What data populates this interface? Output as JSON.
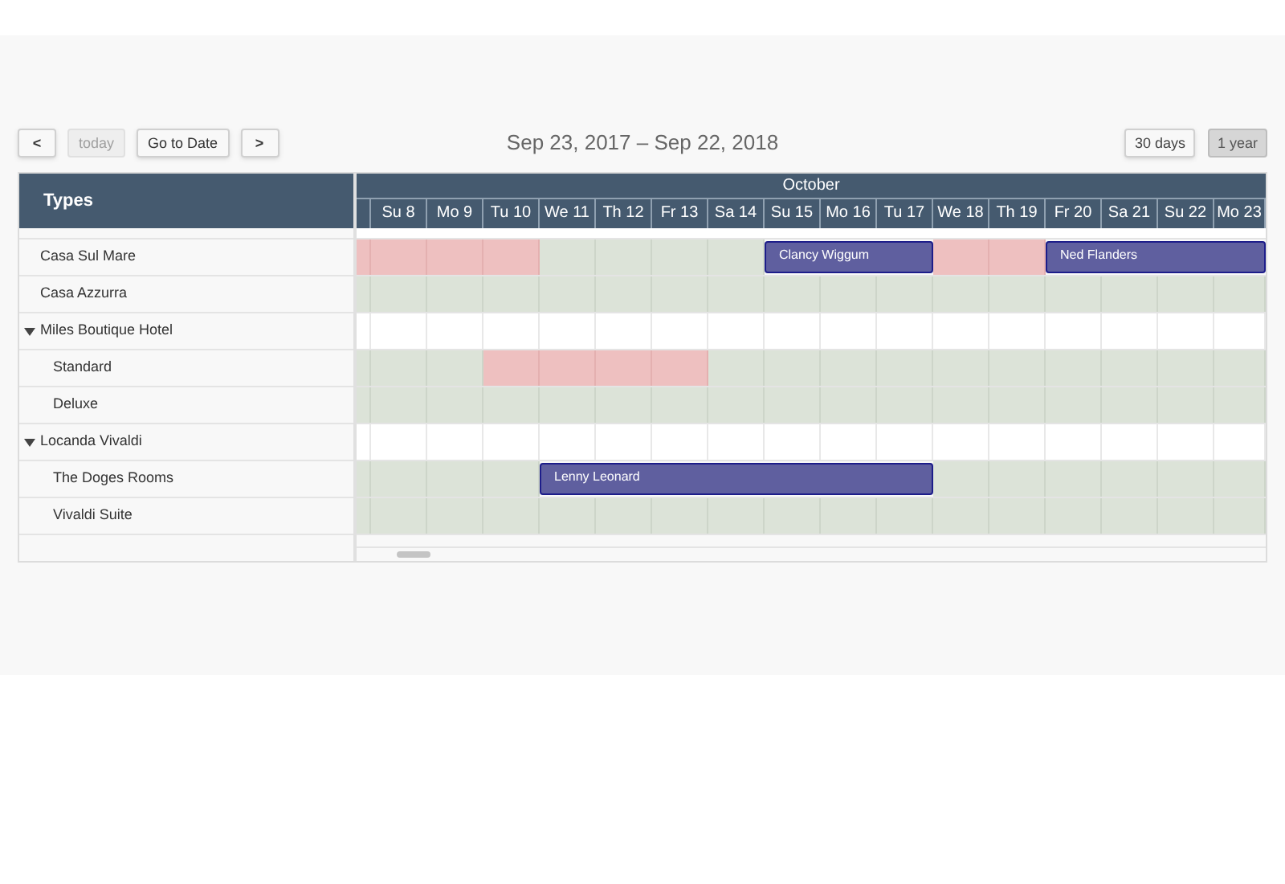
{
  "toolbar": {
    "nav_buttons": [
      {
        "label": "<",
        "kind": "prev",
        "disabled": false
      },
      {
        "label": "today",
        "kind": "today",
        "disabled": true
      },
      {
        "label": "Go to Date",
        "kind": "goto",
        "disabled": false
      },
      {
        "label": ">",
        "kind": "next",
        "disabled": false
      }
    ],
    "title": "Sep 23, 2017 – Sep 22, 2018",
    "view_buttons": [
      {
        "label": "30 days",
        "selected": false
      },
      {
        "label": "1 year",
        "selected": true
      }
    ]
  },
  "resource_header": "Types",
  "month": "October",
  "days": [
    "Su 8",
    "Mo 9",
    "Tu 10",
    "We 11",
    "Th 12",
    "Fr 13",
    "Sa 14",
    "Su 15",
    "Mo 16",
    "Tu 17",
    "We 18",
    "Th 19",
    "Fr 20",
    "Sa 21",
    "Su 22",
    "Mo 23"
  ],
  "resources": [
    {
      "name": "Casa Sul Mare",
      "cells": [
        {
          "kind": "closed"
        },
        {
          "kind": "closed"
        },
        {
          "kind": "closed"
        },
        {
          "kind": "closed"
        },
        {
          "kind": "free"
        },
        {
          "kind": "free"
        },
        {
          "kind": "free"
        },
        {
          "kind": "free"
        },
        {
          "kind": "booked"
        },
        {
          "kind": "booked"
        },
        {
          "kind": "booked"
        },
        {
          "kind": "closed"
        },
        {
          "kind": "closed"
        },
        {
          "kind": "booked"
        },
        {
          "kind": "booked"
        },
        {
          "kind": "booked"
        },
        {
          "kind": "booked"
        }
      ],
      "bookings": [
        "Clancy Wiggum",
        "Ned Flanders"
      ]
    },
    {
      "name": "Casa Azzurra",
      "cells": [
        {
          "kind": "free"
        },
        {
          "kind": "free"
        },
        {
          "kind": "free"
        },
        {
          "kind": "free"
        },
        {
          "kind": "free"
        },
        {
          "kind": "free"
        },
        {
          "kind": "free"
        },
        {
          "kind": "free"
        },
        {
          "kind": "free"
        },
        {
          "kind": "free"
        },
        {
          "kind": "free"
        },
        {
          "kind": "free"
        },
        {
          "kind": "free"
        },
        {
          "kind": "free"
        },
        {
          "kind": "free"
        },
        {
          "kind": "free"
        },
        {
          "kind": "free"
        }
      ]
    },
    {
      "name": "Miles Boutique Hotel",
      "expanded": true,
      "children": [
        {
          "name": "Standard",
          "cells": [
            {
              "kind": "free"
            },
            {
              "kind": "free"
            },
            {
              "kind": "free"
            },
            {
              "kind": "closed"
            },
            {
              "kind": "closed"
            },
            {
              "kind": "closed"
            },
            {
              "kind": "closed"
            },
            {
              "kind": "free"
            },
            {
              "kind": "free"
            },
            {
              "kind": "free"
            },
            {
              "kind": "free"
            },
            {
              "kind": "free"
            },
            {
              "kind": "free"
            },
            {
              "kind": "free"
            },
            {
              "kind": "free"
            },
            {
              "kind": "free"
            },
            {
              "kind": "free"
            }
          ]
        },
        {
          "name": "Deluxe",
          "cells": [
            {
              "kind": "free"
            },
            {
              "kind": "free"
            },
            {
              "kind": "free"
            },
            {
              "kind": "free"
            },
            {
              "kind": "free"
            },
            {
              "kind": "free"
            },
            {
              "kind": "free"
            },
            {
              "kind": "free"
            },
            {
              "kind": "free"
            },
            {
              "kind": "free"
            },
            {
              "kind": "free"
            },
            {
              "kind": "free"
            },
            {
              "kind": "free"
            },
            {
              "kind": "free"
            },
            {
              "kind": "free"
            },
            {
              "kind": "free"
            },
            {
              "kind": "free"
            }
          ]
        }
      ]
    },
    {
      "name": "Locanda Vivaldi",
      "expanded": true,
      "children": [
        {
          "name": "The Doges Rooms",
          "cells": [
            {
              "kind": "free"
            },
            {
              "kind": "free"
            },
            {
              "kind": "free"
            },
            {
              "kind": "free"
            },
            {
              "kind": "booked"
            },
            {
              "kind": "booked"
            },
            {
              "kind": "booked"
            },
            {
              "kind": "booked"
            },
            {
              "kind": "booked"
            },
            {
              "kind": "booked"
            },
            {
              "kind": "booked"
            },
            {
              "kind": "free"
            },
            {
              "kind": "free"
            },
            {
              "kind": "free"
            },
            {
              "kind": "free"
            },
            {
              "kind": "free"
            },
            {
              "kind": "free"
            }
          ],
          "bookings": [
            "Lenny Leonard"
          ]
        },
        {
          "name": "Vivaldi Suite",
          "cells": [
            {
              "kind": "free"
            },
            {
              "kind": "free"
            },
            {
              "kind": "free"
            },
            {
              "kind": "free"
            },
            {
              "kind": "free"
            },
            {
              "kind": "free"
            },
            {
              "kind": "free"
            },
            {
              "kind": "free"
            },
            {
              "kind": "free"
            },
            {
              "kind": "free"
            },
            {
              "kind": "free"
            },
            {
              "kind": "free"
            },
            {
              "kind": "free"
            },
            {
              "kind": "free"
            },
            {
              "kind": "free"
            },
            {
              "kind": "free"
            },
            {
              "kind": "free"
            }
          ]
        }
      ]
    }
  ]
}
